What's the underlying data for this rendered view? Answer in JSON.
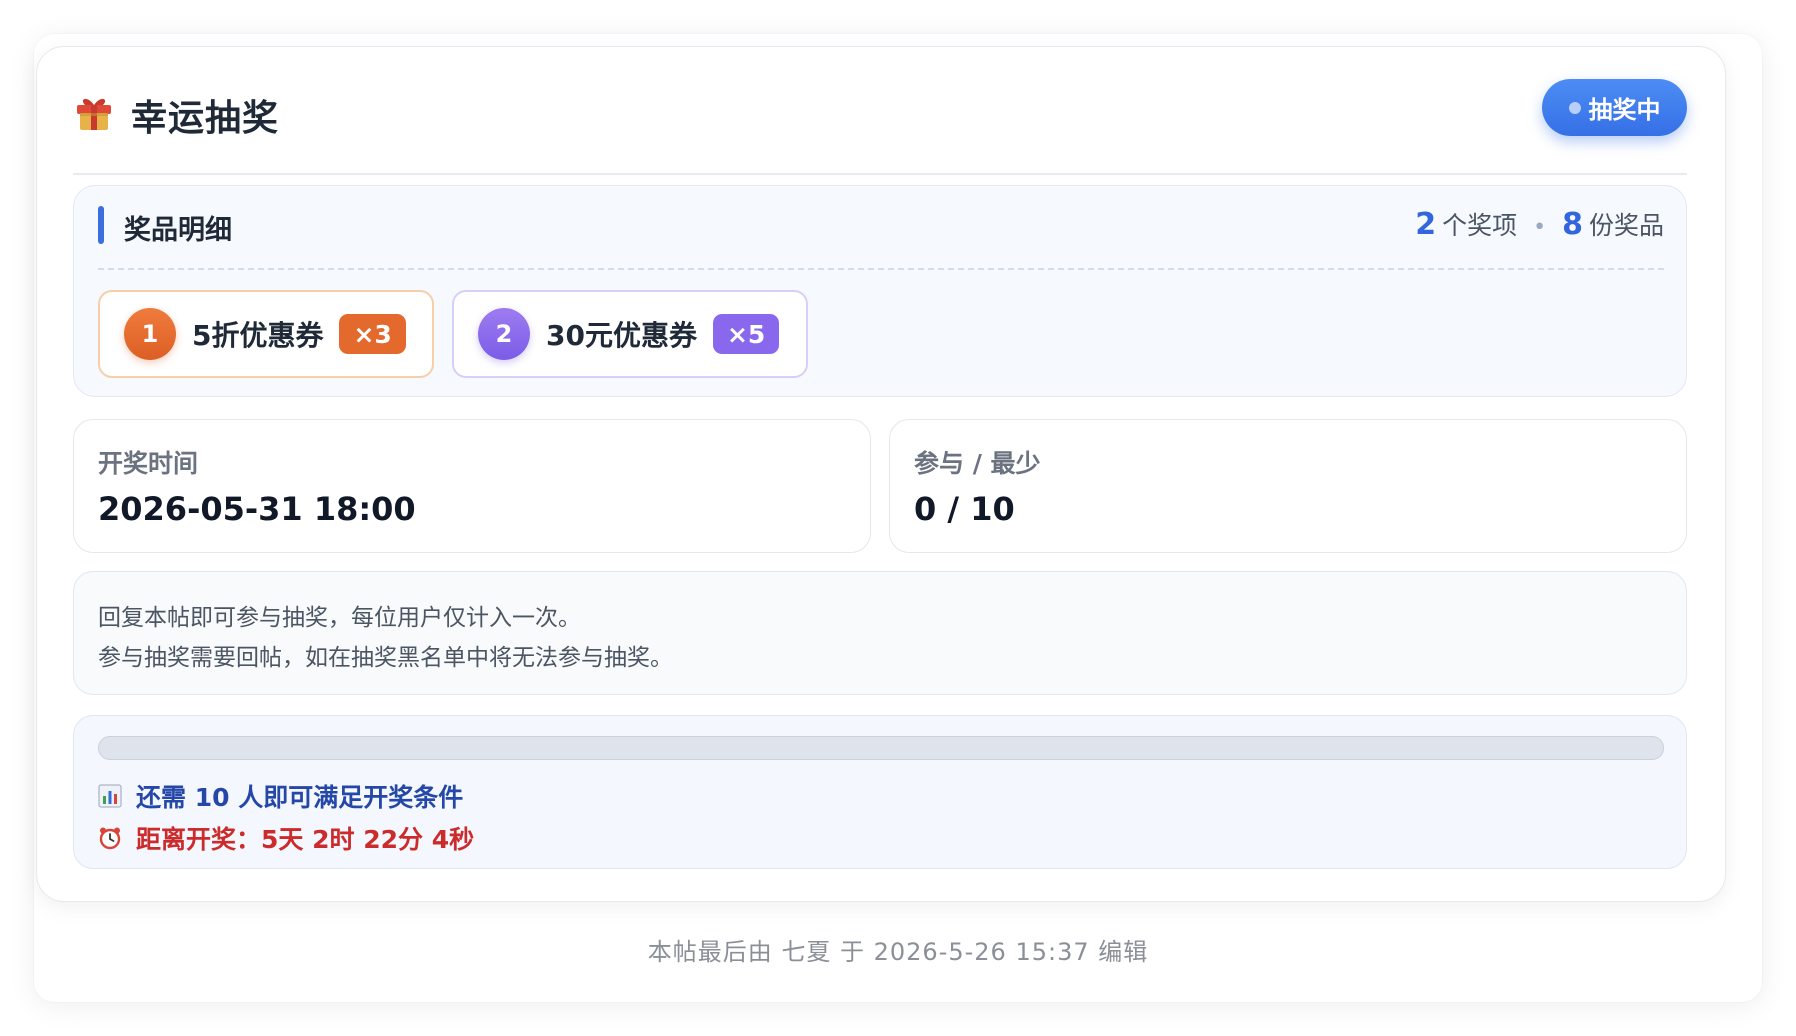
{
  "header": {
    "title": "幸运抽奖",
    "icon": "gift-icon",
    "status_badge": "抽奖中"
  },
  "prizes": {
    "section_title": "奖品明细",
    "summary": {
      "item_count": "2",
      "item_unit": "个奖项",
      "separator": "•",
      "prize_count": "8",
      "prize_unit": "份奖品"
    },
    "items": [
      {
        "rank": "1",
        "name": "5折优惠券",
        "qty": "×3",
        "color": "#e36a2c"
      },
      {
        "rank": "2",
        "name": "30元优惠券",
        "qty": "×5",
        "color": "#8a68ee"
      }
    ]
  },
  "draw_time": {
    "label": "开奖时间",
    "value": "2026-05-31 18:00"
  },
  "participation": {
    "label": "参与 / 最少",
    "value": "0 / 10"
  },
  "rules": [
    "回复本帖即可参与抽奖，每位用户仅计入一次。",
    "参与抽奖需要回帖，如在抽奖黑名单中将无法参与抽奖。"
  ],
  "progress": {
    "percent": 0,
    "need_text": "还需 10 人即可满足开奖条件",
    "need_icon": "bar-chart-icon",
    "countdown_text": "距离开奖：5天 2时 22分 4秒",
    "countdown_icon": "alarm-clock-icon"
  },
  "footer": {
    "edit_note": "本帖最后由 七夏 于 2026-5-26 15:37 编辑"
  },
  "colors": {
    "accent": "#3b6fe0",
    "badge": "#3570e6",
    "countdown": "#cc2b2b",
    "need_text": "#2447a8"
  }
}
